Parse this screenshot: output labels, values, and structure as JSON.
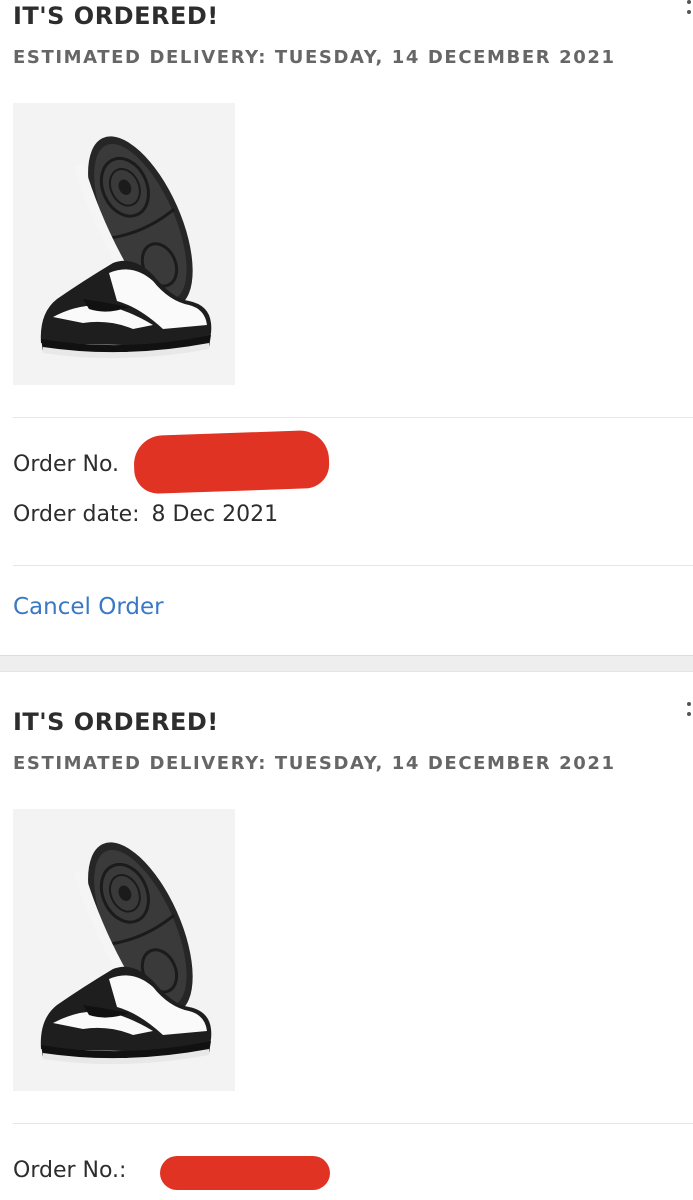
{
  "orders": [
    {
      "status_title": "IT'S ORDERED!",
      "delivery_text": "ESTIMATED DELIVERY: TUESDAY, 14 DECEMBER 2021",
      "product_image": "black-white-low-top-sneakers",
      "order_no_label": "Order No.",
      "order_date_label": "Order date:",
      "order_date_value": "8 Dec 2021",
      "cancel_label": "Cancel Order"
    },
    {
      "status_title": "IT'S ORDERED!",
      "delivery_text": "ESTIMATED DELIVERY: TUESDAY, 14 DECEMBER 2021",
      "product_image": "black-white-low-top-sneakers",
      "order_no_label": "Order No.:"
    }
  ],
  "colors": {
    "heading": "#2d2d2d",
    "subheading": "#666666",
    "link": "#3a78c4",
    "redaction": "#e03324",
    "band": "#eeeeee"
  },
  "icons": [
    "more-options-icon"
  ]
}
